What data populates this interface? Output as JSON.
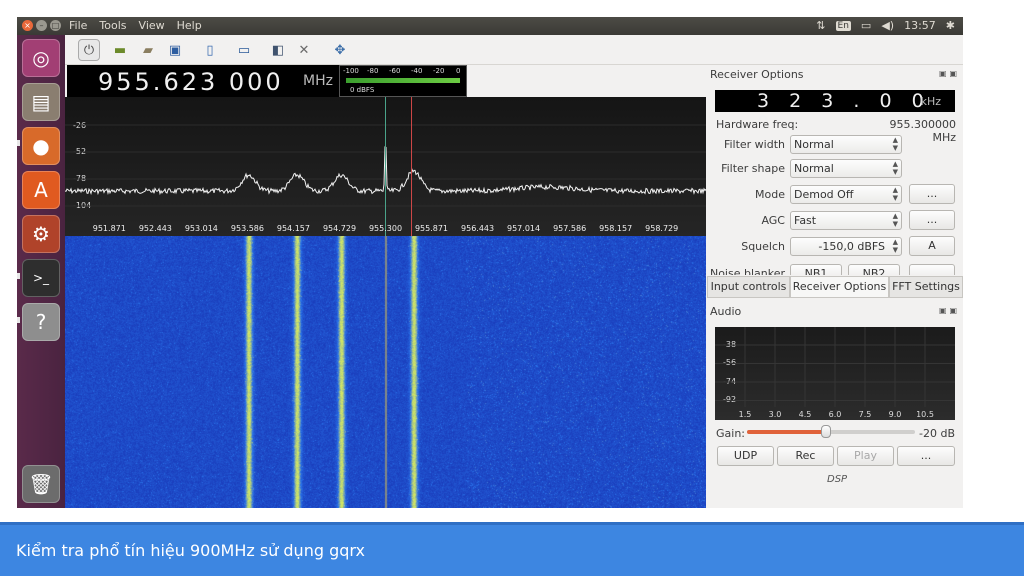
{
  "caption": "Kiểm tra phổ tín hiệu 900MHz sử dụng gqrx",
  "topbar": {
    "menu": [
      "File",
      "Tools",
      "View",
      "Help"
    ],
    "keyboard_layout": "En",
    "clock": "13:57",
    "icons": [
      "network-icon",
      "battery-icon",
      "volume-icon",
      "gear-icon"
    ]
  },
  "launcher": {
    "items": [
      "ubuntu-dash",
      "files",
      "firefox",
      "software-center",
      "system-settings",
      "terminal",
      "help",
      "trash"
    ]
  },
  "toolbar": {
    "icons": [
      "power-icon",
      "hardware-icon",
      "open-icon",
      "save-icon",
      "notes-icon",
      "screenshot-icon",
      "remote-control-icon",
      "tools-icon",
      "center-icon"
    ]
  },
  "freq_display": {
    "value": "955.623 000",
    "unit": "MHz"
  },
  "signal_meter": {
    "ticks": [
      "-100",
      "-80",
      "-60",
      "-40",
      "-20",
      "0"
    ],
    "label": "0 dBFS",
    "level_fraction": 0.98
  },
  "spectrum": {
    "y_labels": [
      "-26",
      "-52",
      "-78",
      "-104"
    ],
    "x_labels": [
      "951.871",
      "952.443",
      "953.014",
      "953.586",
      "954.157",
      "954.729",
      "955.300",
      "955.871",
      "956.443",
      "957.014",
      "957.586",
      "958.157",
      "958.729"
    ],
    "center_freq": 955.3,
    "demod_freq": 955.623,
    "peaks_mhz": [
      953.6,
      954.2,
      954.75,
      955.3,
      955.65
    ]
  },
  "receiver_options": {
    "title": "Receiver Options",
    "freq": {
      "value": "3 2 3 . 0 0 0",
      "unit": "kHz"
    },
    "hw_freq_label": "Hardware freq:",
    "hw_freq_value": "955.300000 MHz",
    "filter_width_label": "Filter width",
    "filter_width_value": "Normal",
    "filter_shape_label": "Filter shape",
    "filter_shape_value": "Normal",
    "mode_label": "Mode",
    "mode_value": "Demod Off",
    "mode_more": "...",
    "agc_label": "AGC",
    "agc_value": "Fast",
    "agc_more": "...",
    "squelch_label": "Squelch",
    "squelch_value": "-150,0 dBFS",
    "squelch_button": "A",
    "noise_blanker_label": "Noise blanker",
    "nb1": "NB1",
    "nb2": "NB2"
  },
  "tabs": [
    "Input controls",
    "Receiver Options",
    "FFT Settings"
  ],
  "active_tab": 1,
  "audio": {
    "title": "Audio",
    "y_labels": [
      "-38",
      "-56",
      "-74",
      "-92"
    ],
    "x_labels": [
      "1.5",
      "3.0",
      "4.5",
      "6.0",
      "7.5",
      "9.0",
      "10.5"
    ],
    "gain_label": "Gain:",
    "gain_value": "-20 dB",
    "gain_fraction": 0.47,
    "buttons": [
      "UDP",
      "Rec",
      "Play",
      "..."
    ],
    "dsp_label": "DSP"
  },
  "colors": {
    "waterfall_base": "#1c3bc4",
    "waterfall_band": "#c9d86a",
    "accent_orange": "#e0623a",
    "caption_bg": "#3d86e1",
    "launcher_bg": "#5a2a4a"
  }
}
